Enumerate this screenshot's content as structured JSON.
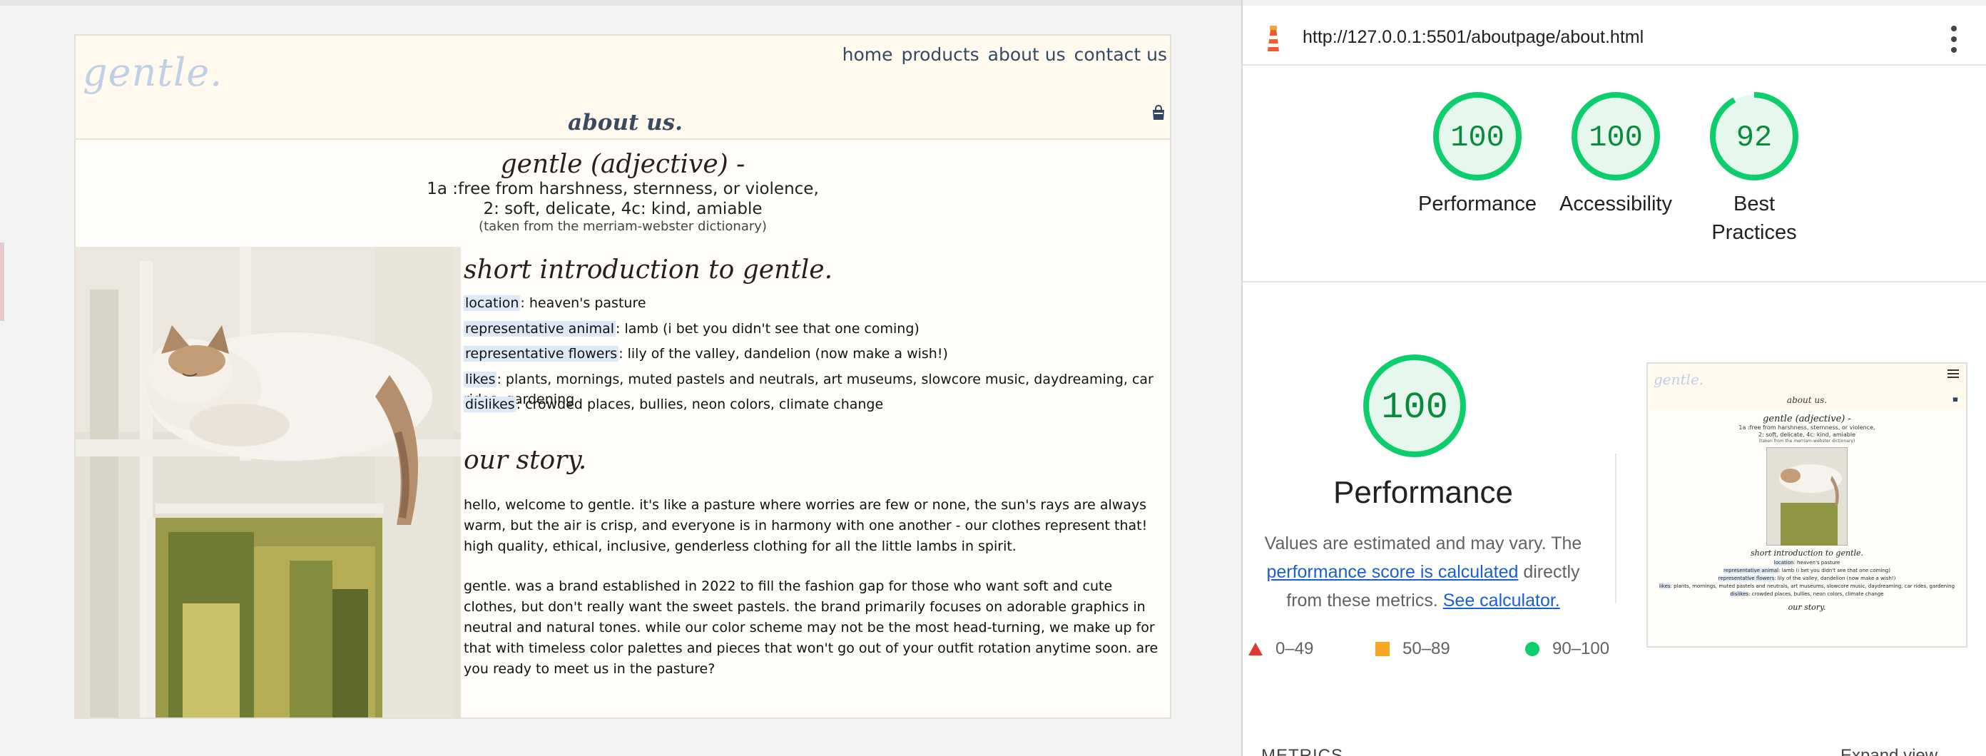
{
  "website": {
    "logo": "gentle.",
    "nav": [
      "home",
      "products",
      "about us",
      "contact us"
    ],
    "page_heading": "about us.",
    "definition": {
      "title": "gentle (adjective) -",
      "line1": "1a :free from harshness, sternness, or violence,",
      "line2": "2: soft, delicate, 4c: kind, amiable",
      "source": "(taken from the merriam-webster dictionary)"
    },
    "intro": {
      "title": "short introduction to gentle.",
      "items": [
        {
          "key": "location",
          "value": ": heaven's pasture"
        },
        {
          "key": "representative animal",
          "value": ": lamb (i bet you didn't see that one coming)"
        },
        {
          "key": "representative flowers",
          "value": ": lily of the valley, dandelion (now make a wish!)"
        },
        {
          "key": "likes",
          "value": ": plants, mornings, muted pastels and neutrals, art museums, slowcore music, daydreaming, car rides, gardening"
        },
        {
          "key": "dislikes",
          "value": ": crowded places, bullies, neon colors, climate change"
        }
      ]
    },
    "story": {
      "title": "our story.",
      "paragraphs": [
        "hello, welcome to gentle. it's like a pasture where worries are few or none, the sun's rays are always warm, but the air is crisp, and everyone is in harmony with one another - our clothes represent that! high quality, ethical, inclusive, genderless clothing for all the little lambs in spirit.",
        "gentle. was a brand established in 2022 to fill the fashion gap for those who want soft and cute clothes, but don't really want the sweet pastels. the brand primarily focuses on adorable graphics in neutral and natural tones. while our color scheme may not be the most head-turning, we make up for that with timeless color palettes and pieces that won't go out of your outfit rotation anytime soon. are you ready to meet us in the pasture?"
      ]
    }
  },
  "lighthouse": {
    "url": "http://127.0.0.1:5501/aboutpage/about.html",
    "scores": [
      {
        "label": "Performance",
        "score": 100,
        "color": "#0cce6b"
      },
      {
        "label": "Accessibility",
        "score": 100,
        "color": "#0cce6b"
      },
      {
        "label": "Best Practices",
        "score": 92,
        "color": "#0cce6b"
      }
    ],
    "main": {
      "score": 100,
      "title": "Performance",
      "desc_before": "Values are estimated and may vary. The ",
      "desc_link": "performance score is calculated",
      "desc_middle": " directly from these metrics. ",
      "desc_link2": "See calculator."
    },
    "legend": [
      {
        "range": "0–49",
        "color": "#e0362b"
      },
      {
        "range": "50–89",
        "color": "#f5a623"
      },
      {
        "range": "90–100",
        "color": "#0cce6b"
      }
    ],
    "metrics_label": "METRICS",
    "expand_label": "Expand view"
  },
  "icons": {
    "cart": "shopping-bag-icon",
    "lighthouse": "lighthouse-icon",
    "menu": "more-vert-icon"
  }
}
